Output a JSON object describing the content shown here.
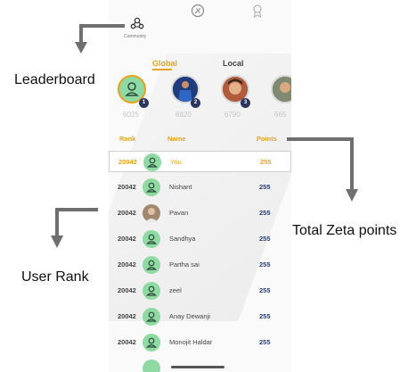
{
  "nav": {
    "community_label": "Community"
  },
  "tabs": {
    "global": "Global",
    "local": "Local"
  },
  "leaderboard": {
    "top": [
      {
        "badge": "1",
        "points": "6025"
      },
      {
        "badge": "2",
        "points": "6820"
      },
      {
        "badge": "3",
        "points": "6790"
      },
      {
        "badge": "",
        "points": "665"
      }
    ]
  },
  "table": {
    "headers": {
      "rank": "Rank",
      "name": "Name",
      "points": "Points"
    },
    "rows": [
      {
        "rank": "20042",
        "name": "You",
        "points": "255",
        "avatar": "user-icon"
      },
      {
        "rank": "20042",
        "name": "Nishant",
        "points": "255",
        "avatar": "user-icon"
      },
      {
        "rank": "20042",
        "name": "Pavan",
        "points": "255",
        "avatar": "photo"
      },
      {
        "rank": "20042",
        "name": "Sandhya",
        "points": "255",
        "avatar": "user-icon"
      },
      {
        "rank": "20042",
        "name": "Partha sai",
        "points": "255",
        "avatar": "user-icon"
      },
      {
        "rank": "20042",
        "name": "zeel",
        "points": "255",
        "avatar": "user-icon"
      },
      {
        "rank": "20042",
        "name": "Anay Dewanji",
        "points": "255",
        "avatar": "user-icon"
      },
      {
        "rank": "20042",
        "name": "Monojit Haldar",
        "points": "255",
        "avatar": "user-icon"
      }
    ]
  },
  "annotations": {
    "leaderboard": "Leaderboard",
    "total_zeta_points": "Total Zeta points",
    "user_rank": "User Rank"
  },
  "colors": {
    "accent": "#e8a320",
    "avatar_green": "#8fd9a3",
    "points_blue": "#2c3e6b",
    "badge": "#2a3560"
  }
}
